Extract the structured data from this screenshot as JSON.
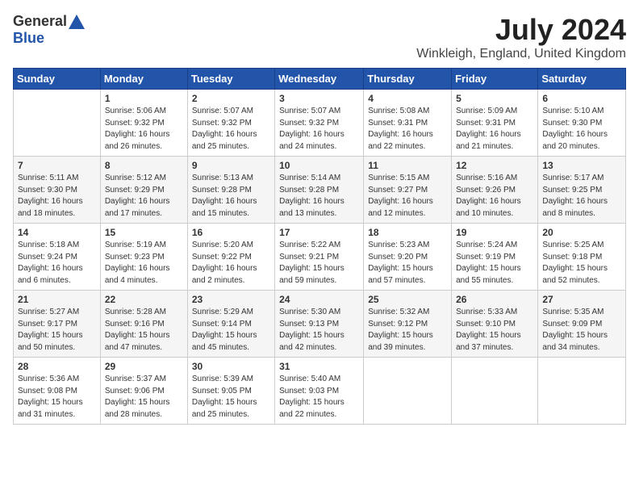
{
  "logo": {
    "general": "General",
    "blue": "Blue"
  },
  "title": "July 2024",
  "subtitle": "Winkleigh, England, United Kingdom",
  "days_header": [
    "Sunday",
    "Monday",
    "Tuesday",
    "Wednesday",
    "Thursday",
    "Friday",
    "Saturday"
  ],
  "weeks": [
    [
      {
        "day": "",
        "info": ""
      },
      {
        "day": "1",
        "info": "Sunrise: 5:06 AM\nSunset: 9:32 PM\nDaylight: 16 hours\nand 26 minutes."
      },
      {
        "day": "2",
        "info": "Sunrise: 5:07 AM\nSunset: 9:32 PM\nDaylight: 16 hours\nand 25 minutes."
      },
      {
        "day": "3",
        "info": "Sunrise: 5:07 AM\nSunset: 9:32 PM\nDaylight: 16 hours\nand 24 minutes."
      },
      {
        "day": "4",
        "info": "Sunrise: 5:08 AM\nSunset: 9:31 PM\nDaylight: 16 hours\nand 22 minutes."
      },
      {
        "day": "5",
        "info": "Sunrise: 5:09 AM\nSunset: 9:31 PM\nDaylight: 16 hours\nand 21 minutes."
      },
      {
        "day": "6",
        "info": "Sunrise: 5:10 AM\nSunset: 9:30 PM\nDaylight: 16 hours\nand 20 minutes."
      }
    ],
    [
      {
        "day": "7",
        "info": "Sunrise: 5:11 AM\nSunset: 9:30 PM\nDaylight: 16 hours\nand 18 minutes."
      },
      {
        "day": "8",
        "info": "Sunrise: 5:12 AM\nSunset: 9:29 PM\nDaylight: 16 hours\nand 17 minutes."
      },
      {
        "day": "9",
        "info": "Sunrise: 5:13 AM\nSunset: 9:28 PM\nDaylight: 16 hours\nand 15 minutes."
      },
      {
        "day": "10",
        "info": "Sunrise: 5:14 AM\nSunset: 9:28 PM\nDaylight: 16 hours\nand 13 minutes."
      },
      {
        "day": "11",
        "info": "Sunrise: 5:15 AM\nSunset: 9:27 PM\nDaylight: 16 hours\nand 12 minutes."
      },
      {
        "day": "12",
        "info": "Sunrise: 5:16 AM\nSunset: 9:26 PM\nDaylight: 16 hours\nand 10 minutes."
      },
      {
        "day": "13",
        "info": "Sunrise: 5:17 AM\nSunset: 9:25 PM\nDaylight: 16 hours\nand 8 minutes."
      }
    ],
    [
      {
        "day": "14",
        "info": "Sunrise: 5:18 AM\nSunset: 9:24 PM\nDaylight: 16 hours\nand 6 minutes."
      },
      {
        "day": "15",
        "info": "Sunrise: 5:19 AM\nSunset: 9:23 PM\nDaylight: 16 hours\nand 4 minutes."
      },
      {
        "day": "16",
        "info": "Sunrise: 5:20 AM\nSunset: 9:22 PM\nDaylight: 16 hours\nand 2 minutes."
      },
      {
        "day": "17",
        "info": "Sunrise: 5:22 AM\nSunset: 9:21 PM\nDaylight: 15 hours\nand 59 minutes."
      },
      {
        "day": "18",
        "info": "Sunrise: 5:23 AM\nSunset: 9:20 PM\nDaylight: 15 hours\nand 57 minutes."
      },
      {
        "day": "19",
        "info": "Sunrise: 5:24 AM\nSunset: 9:19 PM\nDaylight: 15 hours\nand 55 minutes."
      },
      {
        "day": "20",
        "info": "Sunrise: 5:25 AM\nSunset: 9:18 PM\nDaylight: 15 hours\nand 52 minutes."
      }
    ],
    [
      {
        "day": "21",
        "info": "Sunrise: 5:27 AM\nSunset: 9:17 PM\nDaylight: 15 hours\nand 50 minutes."
      },
      {
        "day": "22",
        "info": "Sunrise: 5:28 AM\nSunset: 9:16 PM\nDaylight: 15 hours\nand 47 minutes."
      },
      {
        "day": "23",
        "info": "Sunrise: 5:29 AM\nSunset: 9:14 PM\nDaylight: 15 hours\nand 45 minutes."
      },
      {
        "day": "24",
        "info": "Sunrise: 5:30 AM\nSunset: 9:13 PM\nDaylight: 15 hours\nand 42 minutes."
      },
      {
        "day": "25",
        "info": "Sunrise: 5:32 AM\nSunset: 9:12 PM\nDaylight: 15 hours\nand 39 minutes."
      },
      {
        "day": "26",
        "info": "Sunrise: 5:33 AM\nSunset: 9:10 PM\nDaylight: 15 hours\nand 37 minutes."
      },
      {
        "day": "27",
        "info": "Sunrise: 5:35 AM\nSunset: 9:09 PM\nDaylight: 15 hours\nand 34 minutes."
      }
    ],
    [
      {
        "day": "28",
        "info": "Sunrise: 5:36 AM\nSunset: 9:08 PM\nDaylight: 15 hours\nand 31 minutes."
      },
      {
        "day": "29",
        "info": "Sunrise: 5:37 AM\nSunset: 9:06 PM\nDaylight: 15 hours\nand 28 minutes."
      },
      {
        "day": "30",
        "info": "Sunrise: 5:39 AM\nSunset: 9:05 PM\nDaylight: 15 hours\nand 25 minutes."
      },
      {
        "day": "31",
        "info": "Sunrise: 5:40 AM\nSunset: 9:03 PM\nDaylight: 15 hours\nand 22 minutes."
      },
      {
        "day": "",
        "info": ""
      },
      {
        "day": "",
        "info": ""
      },
      {
        "day": "",
        "info": ""
      }
    ]
  ]
}
